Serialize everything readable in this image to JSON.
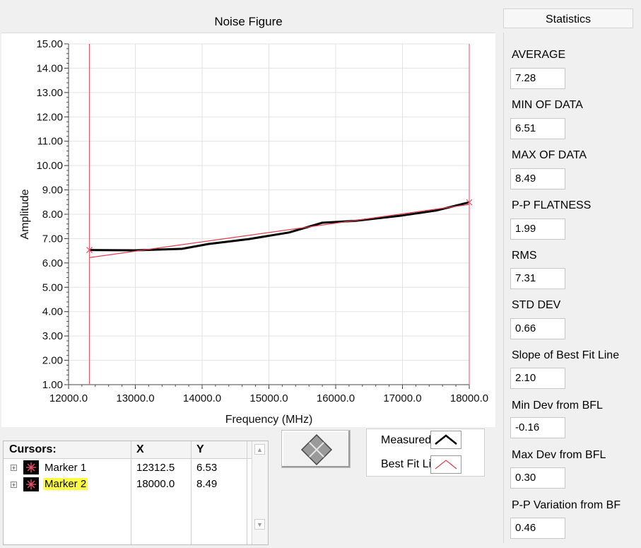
{
  "graph": {
    "title": "Noise Figure"
  },
  "chart_data": {
    "type": "line",
    "xlabel": "Frequency (MHz)",
    "ylabel": "Amplitude",
    "xlim": [
      12000,
      18000
    ],
    "ylim": [
      1,
      15
    ],
    "x_ticks": [
      "12000.0",
      "13000.0",
      "14000.0",
      "15000.0",
      "16000.0",
      "17000.0",
      "18000.0"
    ],
    "y_ticks": [
      "1.00",
      "2.00",
      "3.00",
      "4.00",
      "5.00",
      "6.00",
      "7.00",
      "8.00",
      "9.00",
      "10.00",
      "11.00",
      "12.00",
      "13.00",
      "14.00",
      "15.00"
    ],
    "grid": true,
    "series": [
      {
        "name": "Measured",
        "color": "#000000",
        "x": [
          12312.5,
          13000,
          13700,
          14100,
          14700,
          15300,
          15800,
          16300,
          17000,
          17500,
          18000
        ],
        "y": [
          6.53,
          6.52,
          6.58,
          6.78,
          6.98,
          7.25,
          7.65,
          7.73,
          7.95,
          8.15,
          8.49
        ]
      },
      {
        "name": "Best Fit Line",
        "color": "#e04050",
        "x": [
          12312.5,
          18000
        ],
        "y": [
          6.22,
          8.4
        ]
      }
    ],
    "cursors": [
      {
        "name": "Marker 1",
        "x": 12312.5,
        "y": 6.53,
        "color": "#e8506a"
      },
      {
        "name": "Marker 2",
        "x": 18000.0,
        "y": 8.49,
        "color": "#e8506a"
      }
    ]
  },
  "cursor_table": {
    "headers": [
      "Cursors:",
      "X",
      "Y"
    ],
    "rows": [
      {
        "name": "Marker 1",
        "x": "12312.5",
        "y": "6.53"
      },
      {
        "name": "Marker 2",
        "x": "18000.0",
        "y": "8.49"
      }
    ],
    "highlight_color": "#ffff40"
  },
  "legend": {
    "items": [
      {
        "label": "Measured",
        "icon": "line-swatch-black"
      },
      {
        "label": "Best Fit Line",
        "icon": "line-swatch-red"
      }
    ]
  },
  "palette": {
    "icon": "cursor-movement-diamond-icon"
  },
  "statistics": {
    "title": "Statistics",
    "items": [
      {
        "label": "AVERAGE",
        "value": "7.28"
      },
      {
        "label": "MIN OF DATA",
        "value": "6.51"
      },
      {
        "label": "MAX OF DATA",
        "value": "8.49"
      },
      {
        "label": "P-P FLATNESS",
        "value": "1.99"
      },
      {
        "label": "RMS",
        "value": "7.31"
      },
      {
        "label": "STD DEV",
        "value": "0.66"
      },
      {
        "label": "Slope of Best Fit Line",
        "value": "2.10"
      },
      {
        "label": "Min Dev from BFL",
        "value": "-0.16"
      },
      {
        "label": "Max Dev from BFL",
        "value": "0.30"
      },
      {
        "label": "P-P Variation from BF",
        "value": "0.46"
      }
    ]
  }
}
